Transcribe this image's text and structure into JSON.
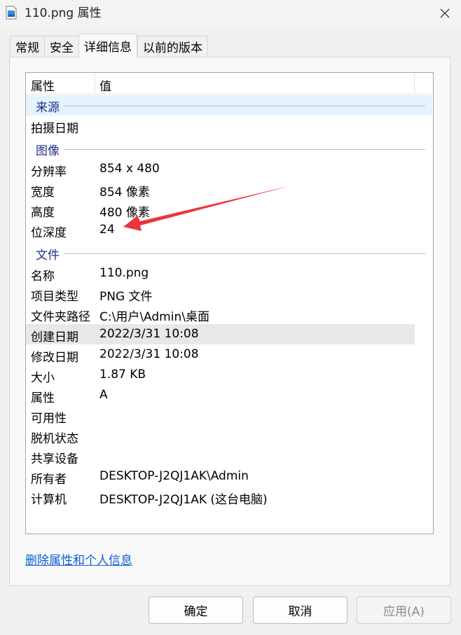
{
  "window": {
    "title": "110.png 属性",
    "icon": "image-file-icon"
  },
  "tabs": [
    {
      "label": "常规",
      "active": false
    },
    {
      "label": "安全",
      "active": false
    },
    {
      "label": "详细信息",
      "active": true
    },
    {
      "label": "以前的版本",
      "active": false
    }
  ],
  "list": {
    "header": {
      "col1": "属性",
      "col2": "值"
    },
    "groups": [
      {
        "label": "来源"
      },
      {
        "label": "图像"
      },
      {
        "label": "文件"
      }
    ],
    "rows": [
      {
        "key": "拍摄日期",
        "value": ""
      },
      {
        "key": "分辨率",
        "value": "854 x 480"
      },
      {
        "key": "宽度",
        "value": "854 像素"
      },
      {
        "key": "高度",
        "value": "480 像素"
      },
      {
        "key": "位深度",
        "value": "24"
      },
      {
        "key": "名称",
        "value": "110.png"
      },
      {
        "key": "项目类型",
        "value": "PNG 文件"
      },
      {
        "key": "文件夹路径",
        "value": "C:\\用户\\Admin\\桌面"
      },
      {
        "key": "创建日期",
        "value": "2022/3/31 10:08"
      },
      {
        "key": "修改日期",
        "value": "2022/3/31 10:08"
      },
      {
        "key": "大小",
        "value": "1.87 KB"
      },
      {
        "key": "属性",
        "value": "A"
      },
      {
        "key": "可用性",
        "value": ""
      },
      {
        "key": "脱机状态",
        "value": ""
      },
      {
        "key": "共享设备",
        "value": ""
      },
      {
        "key": "所有者",
        "value": "DESKTOP-J2QJ1AK\\Admin"
      },
      {
        "key": "计算机",
        "value": "DESKTOP-J2QJ1AK (这台电脑)"
      }
    ]
  },
  "link": "删除属性和个人信息",
  "buttons": {
    "ok": "确定",
    "cancel": "取消",
    "apply": "应用(A)"
  },
  "annotation": {
    "arrow_color": "#e8373a"
  }
}
